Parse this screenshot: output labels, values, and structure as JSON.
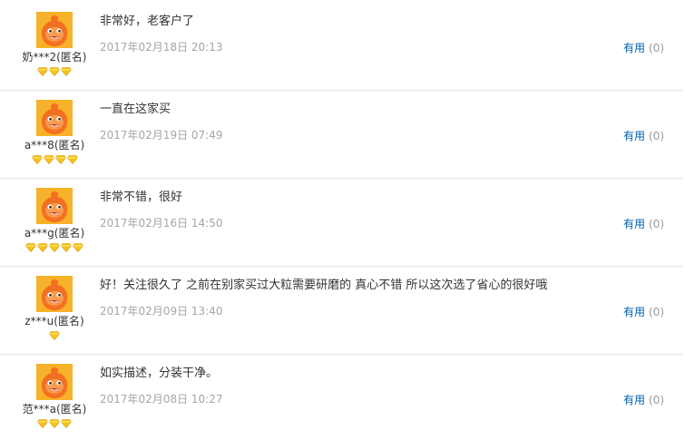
{
  "reviews": [
    {
      "user": "奶***2",
      "anon": "(匿名)",
      "level": 3,
      "text": "非常好，老客户了",
      "date": "2017年02月18日 20:13",
      "useful_label": "有用",
      "useful_count": "(0)"
    },
    {
      "user": "a***8",
      "anon": "(匿名)",
      "level": 4,
      "text": "一直在这家买",
      "date": "2017年02月19日 07:49",
      "useful_label": "有用",
      "useful_count": "(0)"
    },
    {
      "user": "a***g",
      "anon": "(匿名)",
      "level": 5,
      "text": "非常不错，很好",
      "date": "2017年02月16日 14:50",
      "useful_label": "有用",
      "useful_count": "(0)"
    },
    {
      "user": "z***u",
      "anon": "(匿名)",
      "level": 1,
      "text": "好！关注很久了 之前在别家买过大粒需要研磨的 真心不错 所以这次选了省心的很好哦",
      "date": "2017年02月09日 13:40",
      "useful_label": "有用",
      "useful_count": "(0)"
    },
    {
      "user": "范***a",
      "anon": "(匿名)",
      "level": 3,
      "text": "如实描述，分装干净。",
      "date": "2017年02月08日 10:27",
      "useful_label": "有用",
      "useful_count": "(0)"
    }
  ],
  "colors": {
    "avatar_bg": "#f6b22a",
    "avatar_face": "#f36f21",
    "diamond": "#f7c21a",
    "link": "#005ea7"
  }
}
